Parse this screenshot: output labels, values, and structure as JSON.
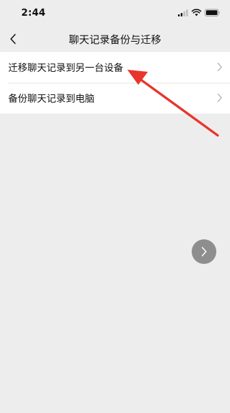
{
  "status_bar": {
    "time": "2:44"
  },
  "nav": {
    "title": "聊天记录备份与迁移",
    "back_icon": "chevron-left-icon"
  },
  "menu": {
    "items": [
      {
        "label": "迁移聊天记录到另一台设备",
        "icon": "chevron-right-icon"
      },
      {
        "label": "备份聊天记录到电脑",
        "icon": "chevron-right-icon"
      }
    ]
  },
  "floating_button": {
    "icon": "chevron-right-icon",
    "color": "#8e8e8e"
  },
  "annotation": {
    "color": "#e8362c"
  }
}
